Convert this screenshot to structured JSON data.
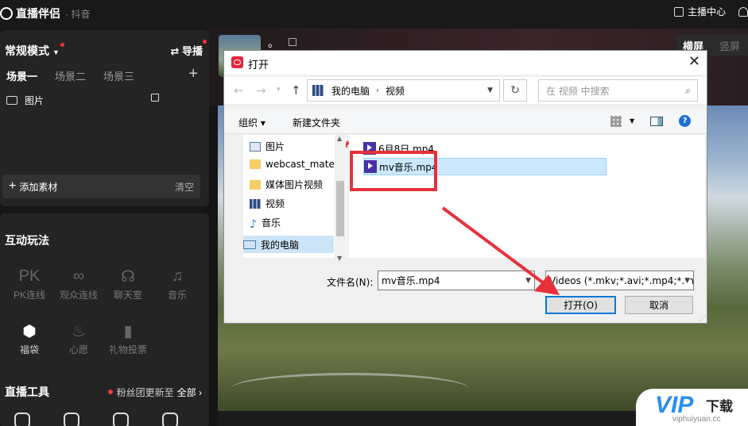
{
  "app": {
    "title": "直播伴侣",
    "subtitle": "· 抖音",
    "anchor_center": "主播中心"
  },
  "scene_panel": {
    "mode": "常规模式",
    "guide": "导播",
    "scenes": [
      "场景一",
      "场景二",
      "场景三"
    ],
    "source_item": "图片",
    "add_material": "添加素材",
    "clear": "清空"
  },
  "interactive": {
    "title": "互动玩法",
    "items": [
      {
        "label": "PK连线",
        "icon": "pk-icon",
        "glyph": "PK",
        "enabled": false
      },
      {
        "label": "观众连线",
        "icon": "audience-link-icon",
        "glyph": "∞",
        "enabled": false
      },
      {
        "label": "聊天室",
        "icon": "chatroom-icon",
        "glyph": "☊",
        "enabled": false
      },
      {
        "label": "音乐",
        "icon": "music-icon",
        "glyph": "♫",
        "enabled": false
      },
      {
        "label": "福袋",
        "icon": "lucky-bag-icon",
        "glyph": "⬢",
        "enabled": true
      },
      {
        "label": "心愿",
        "icon": "wish-icon",
        "glyph": "♨",
        "enabled": false
      },
      {
        "label": "礼物投票",
        "icon": "gift-vote-icon",
        "glyph": "▮",
        "enabled": false
      }
    ],
    "tools_title": "直播工具",
    "fans_update": "粉丝团更新至",
    "all": "全部 ›"
  },
  "preview": {
    "title_dot": "。",
    "landscape": "横屏",
    "portrait": "竖屏"
  },
  "dialog": {
    "title": "打开",
    "breadcrumb": [
      "我的电脑",
      "视频"
    ],
    "search_placeholder": "在 视频 中搜索",
    "organize": "组织 ▾",
    "new_folder": "新建文件夹",
    "nav_items": [
      "图片",
      "webcast_mate",
      "媒体图片视频",
      "视频",
      "音乐"
    ],
    "this_pc": "我的电脑",
    "files": [
      "6月8日.mp4",
      "mv音乐.mp4"
    ],
    "selected_file": "mv音乐.mp4",
    "filename_label": "文件名(N):",
    "filename_value": "mv音乐.mp4",
    "filetype": "Videos (*.mkv;*.avi;*.mp4;*.m",
    "open_button": "打开(O)",
    "cancel_button": "取消"
  },
  "watermark": {
    "brand": "VIP",
    "suffix": "下载",
    "url": "viphuiyuan.cc"
  },
  "colors": {
    "annotation_red": "#e8303a",
    "accent_blue": "#0078d7",
    "selection_blue": "#cce8ff",
    "live_red": "#ff3333"
  }
}
